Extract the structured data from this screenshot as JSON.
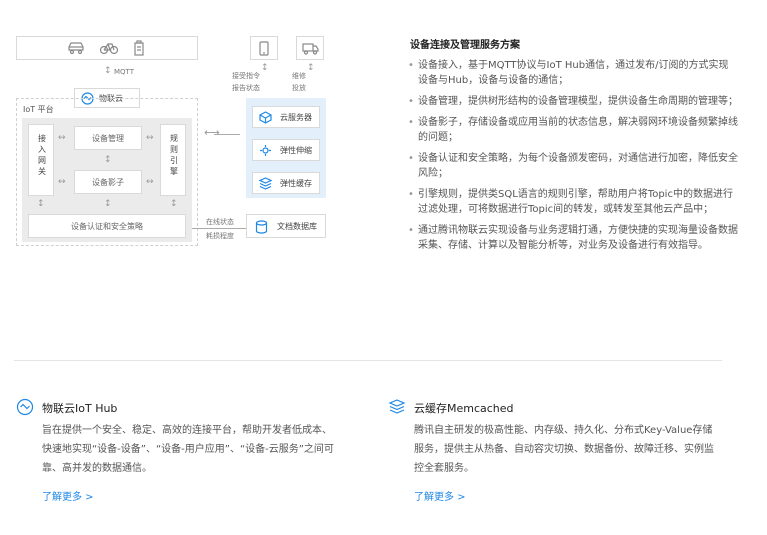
{
  "diagram": {
    "mqtt": "MQTT",
    "hub": "物联云",
    "iot_platform": "IoT 平台",
    "access_gateway": "接入网关",
    "device_management": "设备管理",
    "device_shadow": "设备影子",
    "rule_engine": "规则引擎",
    "auth_policy": "设备认证和安全策略",
    "receive_cmd": "接受指令",
    "report_status": "报告状态",
    "repair": "维修",
    "dispatch": "投放",
    "cloud_server": "云服务器",
    "elastic_scaling": "弹性伸缩",
    "elastic_cache": "弹性缓存",
    "online_status": "在线状态",
    "wear_level": "耗损程度",
    "doc_db": "文档数据库"
  },
  "description": {
    "title": "设备连接及管理服务方案",
    "items": [
      "设备接入，基于MQTT协议与IoT Hub通信，通过发布/订阅的方式实现设备与Hub，设备与设备的通信；",
      "设备管理，提供树形结构的设备管理模型，提供设备生命周期的管理等；",
      "设备影子，存储设备或应用当前的状态信息，解决弱网环境设备频繁掉线的问题；",
      "设备认证和安全策略，为每个设备颁发密码，对通信进行加密，降低安全风险；",
      "引擎规则，提供类SQL语言的规则引擎，帮助用户将Topic中的数据进行过滤处理，可将数据进行Topic间的转发，或转发至其他云产品中；",
      "通过腾讯物联云实现设备与业务逻辑打通，方便快捷的实现海量设备数据采集、存储、计算以及智能分析等，对业务及设备进行有效指导。"
    ]
  },
  "cards": [
    {
      "title": "物联云IoT Hub",
      "desc": "旨在提供一个安全、稳定、高效的连接平台，帮助开发者低成本、快速地实现“设备-设备”、“设备-用户应用”、“设备-云服务”之间可靠、高并发的数据通信。",
      "more": "了解更多 >"
    },
    {
      "title": "云缓存Memcached",
      "desc": "腾讯自主研发的极高性能、内存级、持久化、分布式Key-Value存储服务，提供主从热备、自动容灾切换、数据备份、故障迁移、实例监控全套服务。",
      "more": "了解更多 >"
    }
  ]
}
